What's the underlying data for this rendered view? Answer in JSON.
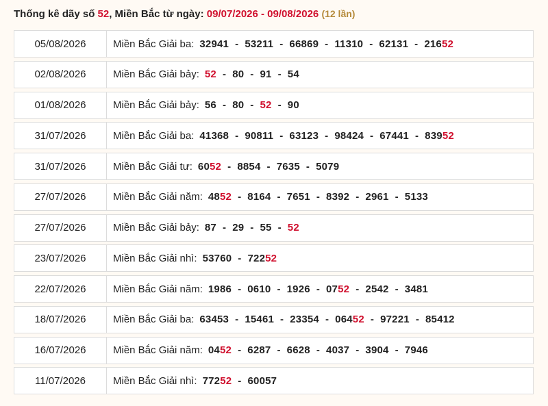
{
  "heading": {
    "prefix": "Thống kê dãy số",
    "number": "52",
    "middle": ", Miền Bắc từ ngày:",
    "range": "09/07/2026 - 09/08/2026",
    "count": "(12 lần)"
  },
  "separator": "-",
  "highlight_color": "#d0102e",
  "rows": [
    {
      "date": "05/08/2026",
      "label": "Miền Bắc Giải ba:",
      "numbers": [
        [
          "32941",
          ""
        ],
        [
          "53211",
          ""
        ],
        [
          "66869",
          ""
        ],
        [
          "11310",
          ""
        ],
        [
          "62131",
          ""
        ],
        [
          "216",
          "52"
        ]
      ]
    },
    {
      "date": "02/08/2026",
      "label": "Miền Bắc Giải bảy:",
      "numbers": [
        [
          "",
          "52"
        ],
        [
          "80",
          ""
        ],
        [
          "91",
          ""
        ],
        [
          "54",
          ""
        ]
      ]
    },
    {
      "date": "01/08/2026",
      "label": "Miền Bắc Giải bảy:",
      "numbers": [
        [
          "56",
          ""
        ],
        [
          "80",
          ""
        ],
        [
          "",
          "52"
        ],
        [
          "90",
          ""
        ]
      ]
    },
    {
      "date": "31/07/2026",
      "label": "Miền Bắc Giải ba:",
      "numbers": [
        [
          "41368",
          ""
        ],
        [
          "90811",
          ""
        ],
        [
          "63123",
          ""
        ],
        [
          "98424",
          ""
        ],
        [
          "67441",
          ""
        ],
        [
          "839",
          "52"
        ]
      ]
    },
    {
      "date": "31/07/2026",
      "label": "Miền Bắc Giải tư:",
      "numbers": [
        [
          "60",
          "52"
        ],
        [
          "8854",
          ""
        ],
        [
          "7635",
          ""
        ],
        [
          "5079",
          ""
        ]
      ]
    },
    {
      "date": "27/07/2026",
      "label": "Miền Bắc Giải năm:",
      "numbers": [
        [
          "48",
          "52"
        ],
        [
          "8164",
          ""
        ],
        [
          "7651",
          ""
        ],
        [
          "8392",
          ""
        ],
        [
          "2961",
          ""
        ],
        [
          "5133",
          ""
        ]
      ]
    },
    {
      "date": "27/07/2026",
      "label": "Miền Bắc Giải bảy:",
      "numbers": [
        [
          "87",
          ""
        ],
        [
          "29",
          ""
        ],
        [
          "55",
          ""
        ],
        [
          "",
          "52"
        ]
      ]
    },
    {
      "date": "23/07/2026",
      "label": "Miền Bắc Giải nhì:",
      "numbers": [
        [
          "53760",
          ""
        ],
        [
          "722",
          "52"
        ]
      ]
    },
    {
      "date": "22/07/2026",
      "label": "Miền Bắc Giải năm:",
      "numbers": [
        [
          "1986",
          ""
        ],
        [
          "0610",
          ""
        ],
        [
          "1926",
          ""
        ],
        [
          "07",
          "52"
        ],
        [
          "2542",
          ""
        ],
        [
          "3481",
          ""
        ]
      ]
    },
    {
      "date": "18/07/2026",
      "label": "Miền Bắc Giải ba:",
      "numbers": [
        [
          "63453",
          ""
        ],
        [
          "15461",
          ""
        ],
        [
          "23354",
          ""
        ],
        [
          "064",
          "52"
        ],
        [
          "97221",
          ""
        ],
        [
          "85412",
          ""
        ]
      ]
    },
    {
      "date": "16/07/2026",
      "label": "Miền Bắc Giải năm:",
      "numbers": [
        [
          "04",
          "52"
        ],
        [
          "6287",
          ""
        ],
        [
          "6628",
          ""
        ],
        [
          "4037",
          ""
        ],
        [
          "3904",
          ""
        ],
        [
          "7946",
          ""
        ]
      ]
    },
    {
      "date": "11/07/2026",
      "label": "Miền Bắc Giải nhì:",
      "numbers": [
        [
          "772",
          "52"
        ],
        [
          "60057",
          ""
        ]
      ]
    }
  ]
}
